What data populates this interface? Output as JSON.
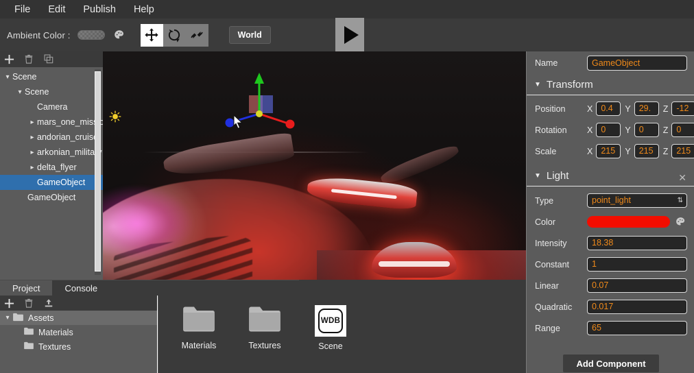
{
  "menu": {
    "items": [
      {
        "label": "File",
        "name": "menu-file"
      },
      {
        "label": "Edit",
        "name": "menu-edit"
      },
      {
        "label": "Publish",
        "name": "menu-publish"
      },
      {
        "label": "Help",
        "name": "menu-help"
      }
    ]
  },
  "toolbar": {
    "ambient_color_label": "Ambient Color :",
    "ambient_color_value": "#6d6d6d",
    "palette_icon": "palette-icon",
    "gizmos": [
      {
        "name": "translate-gizmo",
        "icon": "move-arrows-icon",
        "active": true
      },
      {
        "name": "rotate-gizmo",
        "icon": "rotate-arrow-icon",
        "active": false
      },
      {
        "name": "scale-gizmo",
        "icon": "scale-arrows-icon",
        "active": false
      }
    ],
    "space_toggle": "World",
    "play_button": "play-icon"
  },
  "hierarchy": {
    "tools": [
      {
        "name": "add-object-button",
        "icon": "plus-icon"
      },
      {
        "name": "delete-object-button",
        "icon": "trash-icon"
      },
      {
        "name": "duplicate-object-button",
        "icon": "copy-icon"
      }
    ],
    "items": [
      {
        "label": "Scene",
        "indent": 0,
        "twisty": "down",
        "selected": false
      },
      {
        "label": "Scene",
        "indent": 1,
        "twisty": "down",
        "selected": false
      },
      {
        "label": "Camera",
        "indent": 2,
        "twisty": "",
        "selected": false
      },
      {
        "label": "mars_one_mission",
        "indent": 2,
        "twisty": "right",
        "selected": false
      },
      {
        "label": "andorian_cruiser",
        "indent": 2,
        "twisty": "right",
        "selected": false
      },
      {
        "label": "arkonian_military",
        "indent": 2,
        "twisty": "right",
        "selected": false
      },
      {
        "label": "delta_flyer",
        "indent": 2,
        "twisty": "right",
        "selected": false
      },
      {
        "label": "GameObject",
        "indent": 2,
        "twisty": "",
        "selected": true
      },
      {
        "label": "GameObject",
        "indent": 1,
        "twisty": "",
        "selected": false
      }
    ]
  },
  "inspector": {
    "name_label": "Name",
    "name_value": "GameObject",
    "transform": {
      "title": "Transform",
      "rows": [
        {
          "label": "Position",
          "x": "0.4",
          "y": "29.",
          "z": "-12"
        },
        {
          "label": "Rotation",
          "x": "0",
          "y": "0",
          "z": "0"
        },
        {
          "label": "Scale",
          "x": "215",
          "y": "215",
          "z": "215"
        }
      ],
      "axis_labels": [
        "X",
        "Y",
        "Z"
      ]
    },
    "light": {
      "title": "Light",
      "close_icon": "close-icon",
      "type_label": "Type",
      "type_value": "point_light",
      "color_label": "Color",
      "color_value": "#f20d00",
      "palette_icon": "palette-icon",
      "props": [
        {
          "label": "Intensity",
          "value": "18.38"
        },
        {
          "label": "Constant",
          "value": "1"
        },
        {
          "label": "Linear",
          "value": "0.07"
        },
        {
          "label": "Quadratic",
          "value": "0.017"
        },
        {
          "label": "Range",
          "value": "65"
        }
      ]
    },
    "add_component": "Add Component"
  },
  "bottom": {
    "tabs": [
      {
        "label": "Project",
        "active": true
      },
      {
        "label": "Console",
        "active": false
      }
    ],
    "tools": [
      {
        "name": "add-asset-button",
        "icon": "plus-icon"
      },
      {
        "name": "delete-asset-button",
        "icon": "trash-icon"
      },
      {
        "name": "import-asset-button",
        "icon": "upload-icon"
      }
    ],
    "tree": [
      {
        "label": "Assets",
        "indent": 0,
        "twisty": "down",
        "selected": true
      },
      {
        "label": "Materials",
        "indent": 1,
        "twisty": "",
        "selected": false
      },
      {
        "label": "Textures",
        "indent": 1,
        "twisty": "",
        "selected": false
      }
    ],
    "assets": [
      {
        "label": "Materials",
        "icon": "folder-icon"
      },
      {
        "label": "Textures",
        "icon": "folder-icon"
      },
      {
        "label": "Scene",
        "icon": "wdb-file-icon",
        "badge": "WDB"
      }
    ]
  },
  "viewport": {
    "name": "3d-scene-viewport",
    "gizmo": "translate-gizmo-3d",
    "light_gizmo": "point-light-gizmo-icon",
    "cursor": "mouse-cursor"
  }
}
